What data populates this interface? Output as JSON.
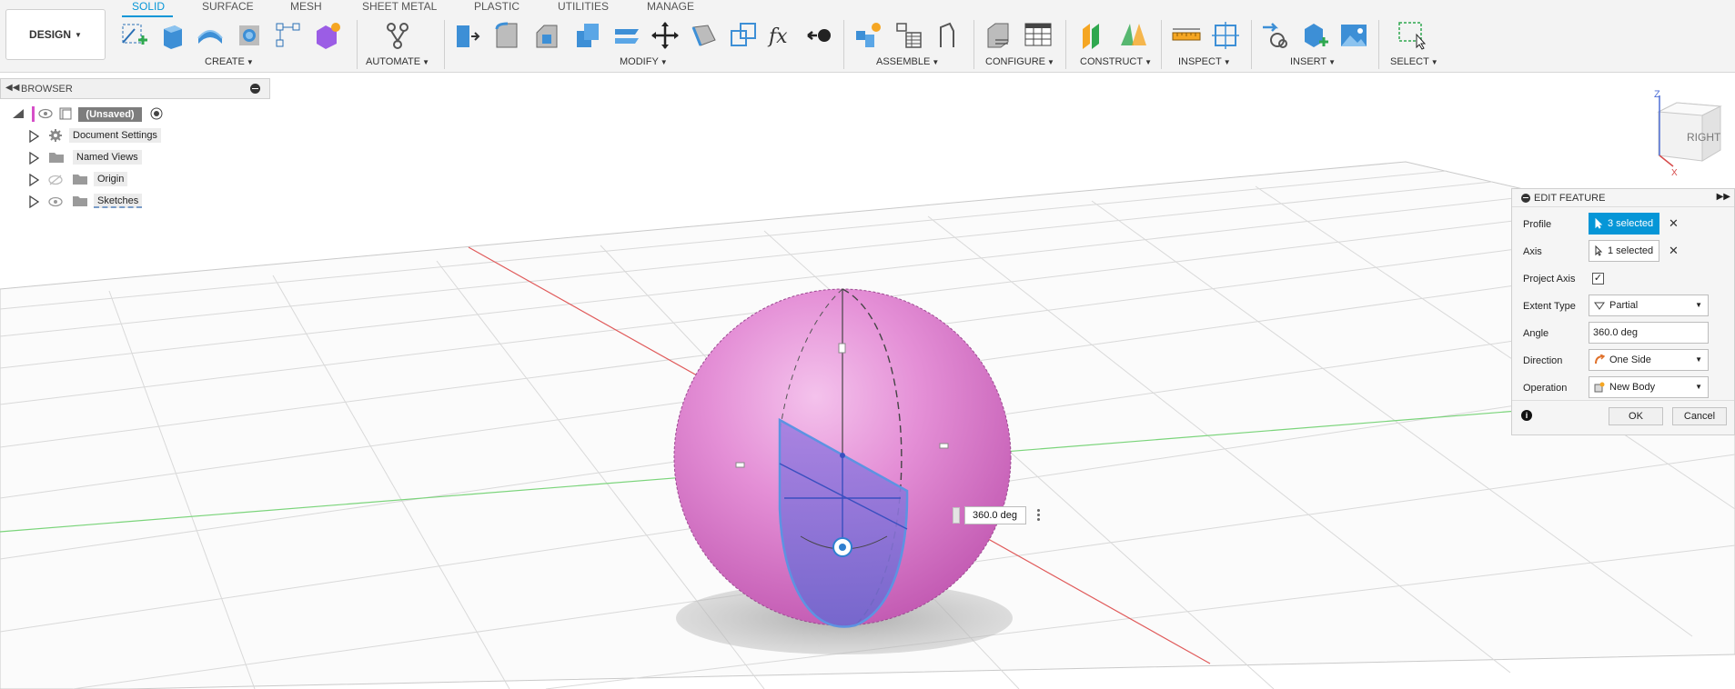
{
  "app": {
    "design_label": "DESIGN"
  },
  "tabs": [
    "SOLID",
    "SURFACE",
    "MESH",
    "SHEET METAL",
    "PLASTIC",
    "UTILITIES",
    "MANAGE"
  ],
  "groups": {
    "create": "CREATE",
    "automate": "AUTOMATE",
    "modify": "MODIFY",
    "assemble": "ASSEMBLE",
    "configure": "CONFIGURE",
    "construct": "CONSTRUCT",
    "inspect": "INSPECT",
    "insert": "INSERT",
    "select": "SELECT"
  },
  "browser": {
    "title": "BROWSER",
    "root": "(Unsaved)",
    "items": [
      {
        "label": "Document Settings",
        "icon": "gear-icon"
      },
      {
        "label": "Named Views",
        "icon": "folder-icon"
      },
      {
        "label": "Origin",
        "icon": "folder-icon"
      },
      {
        "label": "Sketches",
        "icon": "folder-icon"
      }
    ]
  },
  "viewcube": {
    "face_label": "RIGHT",
    "z_label": "Z",
    "x_label": "X"
  },
  "viewport": {
    "angle_value": "360.0 deg"
  },
  "edit_feature": {
    "title": "EDIT FEATURE",
    "profile_label": "Profile",
    "profile_value": "3 selected",
    "axis_label": "Axis",
    "axis_value": "1 selected",
    "project_axis_label": "Project Axis",
    "project_axis_checked": "✓",
    "extent_type_label": "Extent Type",
    "extent_type_value": "Partial",
    "angle_label": "Angle",
    "angle_value": "360.0 deg",
    "direction_label": "Direction",
    "direction_value": "One Side",
    "operation_label": "Operation",
    "operation_value": "New Body",
    "ok_label": "OK",
    "cancel_label": "Cancel",
    "close_glyph": "✕"
  },
  "colors": {
    "accent": "#0696d7",
    "sphere": "#e07ed1",
    "profile": "#7a7fd6",
    "x_axis": "#e05a5a",
    "y_axis": "#6ccf6c"
  }
}
